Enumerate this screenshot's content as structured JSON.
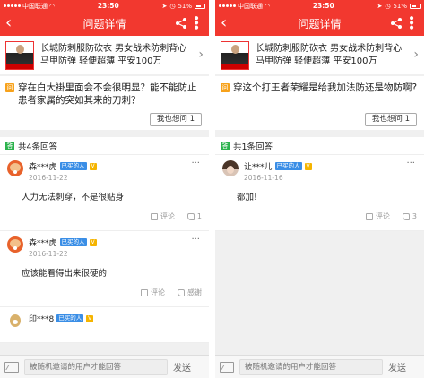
{
  "left": {
    "status": {
      "carrier": "中国联通",
      "time": "23:50",
      "battery": "51%"
    },
    "nav": {
      "title": "问题详情"
    },
    "product": {
      "title": "长城防刺服防砍衣 男女战术防刺背心马甲防弹 轻便超薄 平安100万"
    },
    "question": {
      "badge": "问",
      "text": "穿在白大褂里面会不会很明显？能不能防止患者家属的突如其来的刀刺？",
      "ask_label": "我也想问",
      "ask_count": "1"
    },
    "answers_header": {
      "badge": "答",
      "title": "共4条回答"
    },
    "answers": [
      {
        "user": "森***虎",
        "badge": "已买的人",
        "vip": "V",
        "date": "2016-11-22",
        "text": "人力无法刺穿，不是很贴身",
        "comment": "评论",
        "likes": "1"
      },
      {
        "user": "森***虎",
        "badge": "已买的人",
        "vip": "V",
        "date": "2016-11-22",
        "text": "应该能看得出来很硬的",
        "comment": "评论",
        "likes": "感谢"
      },
      {
        "user": "印***8",
        "badge": "已买的人",
        "vip": "V",
        "date": "",
        "text": "",
        "comment": "",
        "likes": ""
      }
    ],
    "footer": {
      "placeholder": "被随机邀请的用户才能回答",
      "send": "发送"
    }
  },
  "right": {
    "status": {
      "carrier": "中国联通",
      "time": "23:50",
      "battery": "51%"
    },
    "nav": {
      "title": "问题详情"
    },
    "product": {
      "title": "长城防刺服防砍衣 男女战术防刺背心马甲防弹 轻便超薄 平安100万"
    },
    "question": {
      "badge": "问",
      "text": "穿这个打王者荣耀是给我加法防还是物防啊?",
      "ask_label": "我也想问",
      "ask_count": "1"
    },
    "answers_header": {
      "badge": "答",
      "title": "共1条回答"
    },
    "answers": [
      {
        "user": "让***儿",
        "badge": "已买的人",
        "vip": "V",
        "date": "2016-11-16",
        "text": "都加!",
        "comment": "评论",
        "likes": "3"
      }
    ],
    "footer": {
      "placeholder": "被随机邀请的用户才能回答",
      "send": "发送"
    }
  },
  "colors": {
    "accent": "#f2382f",
    "question_badge": "#f7a21b",
    "answer_badge": "#2bb24c",
    "buyer_badge": "#3a8ee6"
  }
}
